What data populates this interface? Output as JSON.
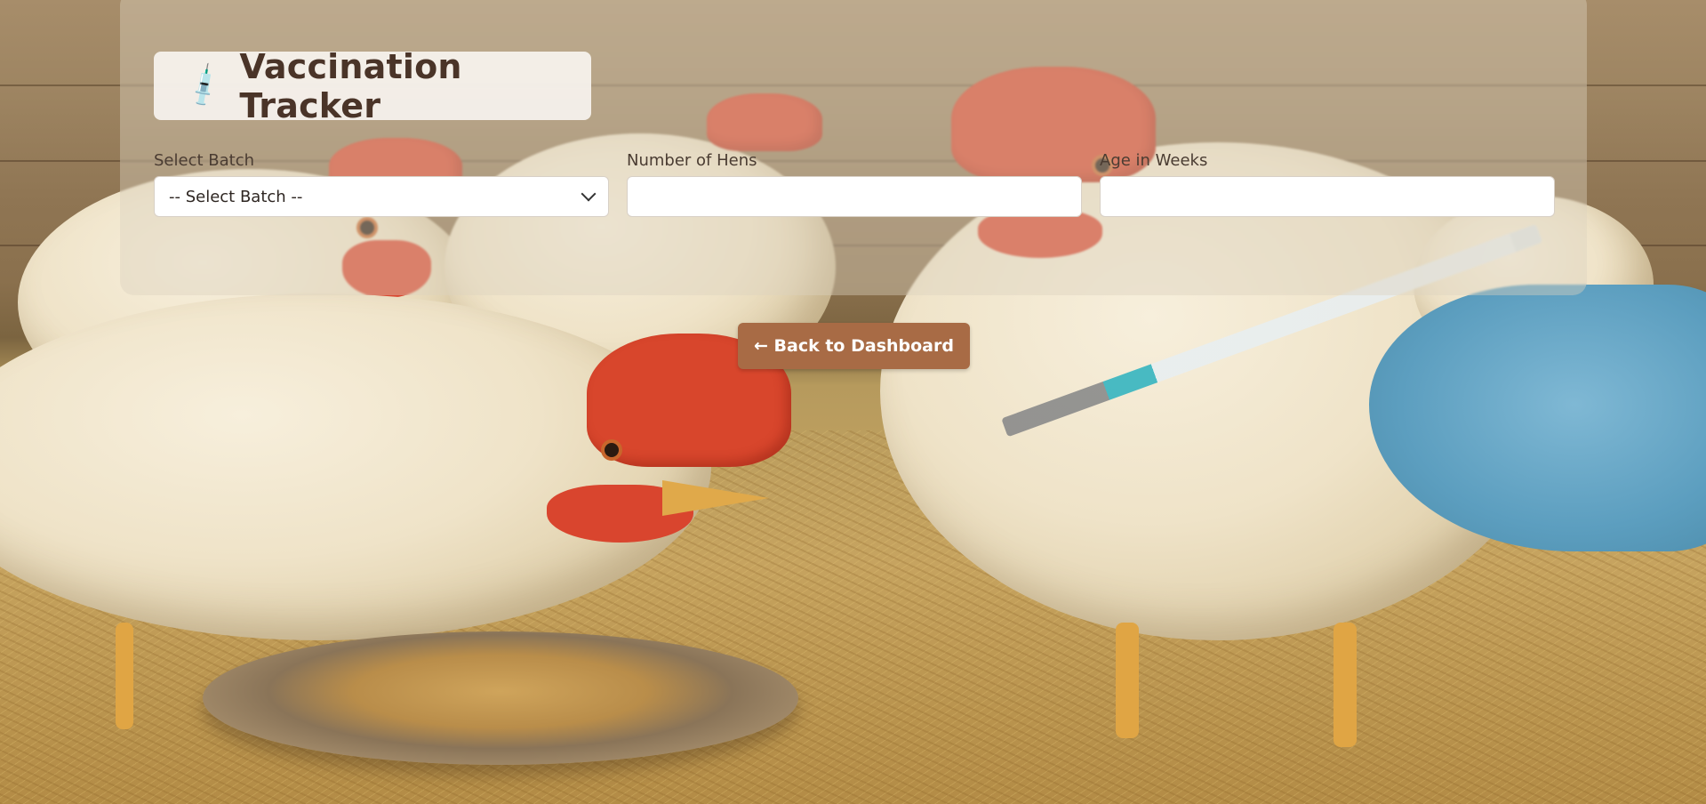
{
  "header": {
    "icon": "syringe-icon",
    "icon_glyph": "💉",
    "title": "Vaccination Tracker"
  },
  "form": {
    "batch": {
      "label": "Select Batch",
      "selected": "-- Select Batch --"
    },
    "hens": {
      "label": "Number of Hens",
      "value": ""
    },
    "age": {
      "label": "Age in Weeks",
      "value": ""
    }
  },
  "actions": {
    "back_label": "← Back to Dashboard"
  },
  "colors": {
    "accent": "#a86b45",
    "title_text": "#4a3428"
  }
}
